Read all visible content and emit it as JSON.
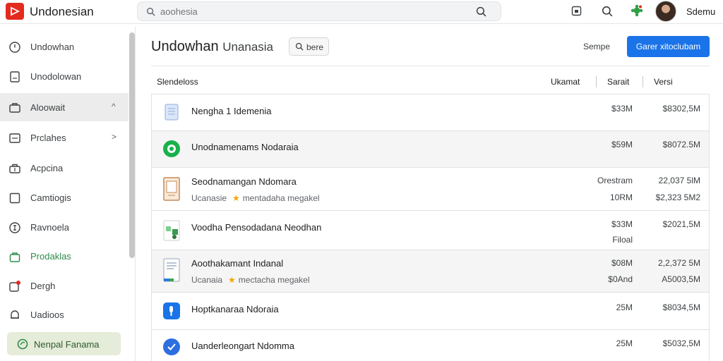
{
  "app": {
    "title": "Undonesian",
    "username": "Sdemu"
  },
  "search": {
    "value": "",
    "placeholder": "aoohesia"
  },
  "sidebar": {
    "items": [
      {
        "label": "Undowhan",
        "icon": "clock-icon"
      },
      {
        "label": "Unodolowan",
        "icon": "document-icon"
      },
      {
        "label": "Aloowait",
        "icon": "folder-icon",
        "chevron": "^"
      },
      {
        "label": "Prclahes",
        "icon": "image-icon",
        "chevron": ">"
      },
      {
        "label": "Acpcina",
        "icon": "briefcase-icon"
      },
      {
        "label": "Camtiogis",
        "icon": "box-icon"
      },
      {
        "label": "Ravnoela",
        "icon": "coin-icon"
      },
      {
        "label": "Prodaklas",
        "icon": "bag-icon"
      },
      {
        "label": "Dergh",
        "icon": "notification-icon"
      },
      {
        "label": "Uadioos",
        "icon": "bell-icon"
      }
    ],
    "action": "Nenpal Fanama"
  },
  "main": {
    "title": "Undowhan",
    "subtitle": "Unanasia",
    "filter_label": "bere",
    "sort_label": "Sempe",
    "primary_button": "Garer xitoclubam",
    "columns": [
      "Slendeloss",
      "Ukamat",
      "Sarait",
      "Versi"
    ],
    "rows": [
      {
        "icon": "doc-icon",
        "name": "Nengha 1 Idemenia",
        "sub": "",
        "sub_tag": "",
        "c1": [
          "$33M"
        ],
        "c2": [
          "$8302,5M"
        ]
      },
      {
        "icon": "chat-icon",
        "name": "Unodnamenams Nodaraia",
        "sub": "",
        "sub_tag": "",
        "c1": [
          "$59M"
        ],
        "c2": [
          "$8072.5M"
        ]
      },
      {
        "icon": "certificate-icon",
        "name": "Seodnamangan Ndomara",
        "sub": "Ucanasie",
        "sub_tag": "mentadaha megakel",
        "c1": [
          "Orestram",
          "10RM"
        ],
        "c2": [
          "22,037 5lM",
          "$2,323 5M2"
        ]
      },
      {
        "icon": "spreadsheet-icon",
        "name": "Voodha Pensodadana Neodhan",
        "sub": "",
        "sub_tag": "",
        "c1": [
          "$33M",
          "Filoal"
        ],
        "c2": [
          "$2021,5M"
        ]
      },
      {
        "icon": "report-icon",
        "name": "Aoothakamant Indanal",
        "sub": "Ucanaia",
        "sub_tag": "mectacha megakel",
        "c1": [
          "$08M",
          "$0And"
        ],
        "c2": [
          "2,2,372 5M",
          "A5003,5M"
        ]
      },
      {
        "icon": "app-icon",
        "name": "Hoptkanaraa Ndoraia",
        "sub": "",
        "sub_tag": "",
        "c1": [
          "25M"
        ],
        "c2": [
          "$8034,5M"
        ]
      },
      {
        "icon": "check-circle-icon",
        "name": "Uanderleongart Ndomma",
        "sub": "",
        "sub_tag": "",
        "c1": [
          "25M"
        ],
        "c2": [
          "$5032,5M"
        ]
      }
    ]
  },
  "colors": {
    "accent": "#1a73e8",
    "brand": "#e32a1f",
    "sidebar_action_bg": "#e5ecd9",
    "green": "#2f8a4a"
  }
}
